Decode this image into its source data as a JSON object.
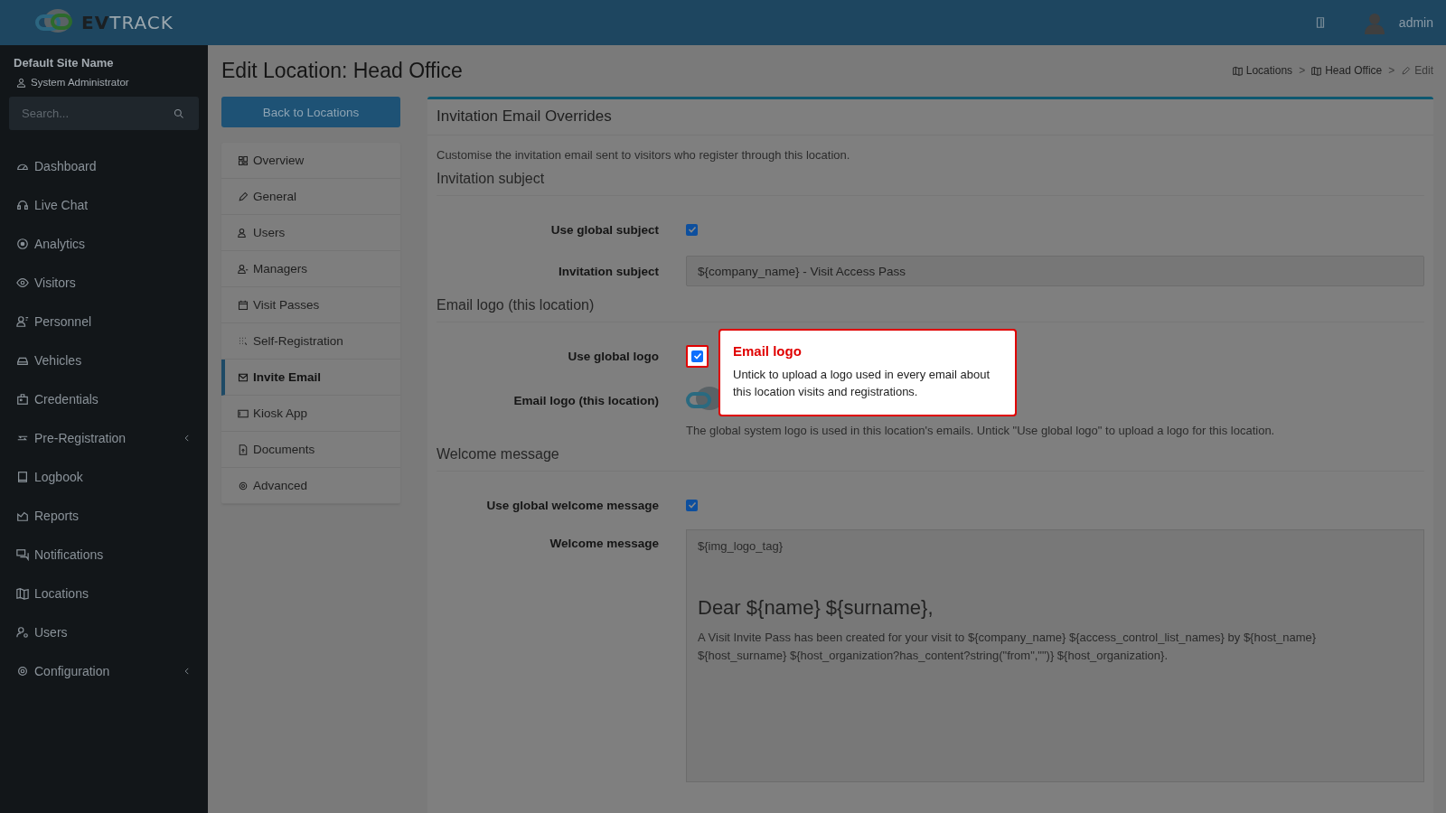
{
  "header": {
    "logo_text": "**EV**TRACK",
    "user": "admin"
  },
  "sidebar": {
    "site_name": "Default Site Name",
    "role": "System Administrator",
    "search_placeholder": "Search...",
    "items": [
      {
        "label": "Dashboard",
        "has_submenu": false
      },
      {
        "label": "Live Chat",
        "has_submenu": false
      },
      {
        "label": "Analytics",
        "has_submenu": false
      },
      {
        "label": "Visitors",
        "has_submenu": false
      },
      {
        "label": "Personnel",
        "has_submenu": false
      },
      {
        "label": "Vehicles",
        "has_submenu": false
      },
      {
        "label": "Credentials",
        "has_submenu": false
      },
      {
        "label": "Pre-Registration",
        "has_submenu": true
      },
      {
        "label": "Logbook",
        "has_submenu": false
      },
      {
        "label": "Reports",
        "has_submenu": false
      },
      {
        "label": "Notifications",
        "has_submenu": false
      },
      {
        "label": "Locations",
        "has_submenu": false
      },
      {
        "label": "Users",
        "has_submenu": false
      },
      {
        "label": "Configuration",
        "has_submenu": true
      }
    ]
  },
  "page": {
    "title": "Edit Location: Head Office",
    "back_button": "Back to Locations",
    "breadcrumb": {
      "separator": ">",
      "items": [
        {
          "label": "Locations",
          "kind": "map"
        },
        {
          "label": "Head Office",
          "kind": "map"
        },
        {
          "label": "Edit",
          "kind": "edit"
        }
      ]
    }
  },
  "tabs": [
    {
      "label": "Overview",
      "selected": false
    },
    {
      "label": "General",
      "selected": false
    },
    {
      "label": "Users",
      "selected": false
    },
    {
      "label": "Managers",
      "selected": false
    },
    {
      "label": "Visit Passes",
      "selected": false
    },
    {
      "label": "Self-Registration",
      "selected": false
    },
    {
      "label": "Invite Email",
      "selected": true
    },
    {
      "label": "Kiosk App",
      "selected": false
    },
    {
      "label": "Documents",
      "selected": false
    },
    {
      "label": "Advanced",
      "selected": false
    }
  ],
  "card": {
    "title": "Invitation Email Overrides",
    "description": "Customise the invitation email sent to visitors who register through this location.",
    "sections": [
      {
        "heading": "Invitation subject",
        "fields": [
          {
            "kind": "checkbox",
            "label": "Use global subject",
            "checked": true,
            "highlighted": false
          },
          {
            "kind": "text",
            "label": "Invitation subject",
            "value": "${company_name} - Visit Access Pass"
          }
        ]
      },
      {
        "heading": "Email logo (this location)",
        "fields": [
          {
            "kind": "checkbox",
            "label": "Use global logo",
            "checked": true,
            "highlighted": true
          },
          {
            "kind": "logo",
            "label": "Email logo (this location)",
            "help": "The global system logo is used in this location's emails. Untick \"Use global logo\" to upload a logo for this location."
          }
        ]
      },
      {
        "heading": "Welcome message",
        "fields": [
          {
            "kind": "checkbox",
            "label": "Use global welcome message",
            "checked": true,
            "highlighted": false
          },
          {
            "kind": "textarea",
            "label": "Welcome message",
            "lines": [
              {
                "kind": "plain",
                "text": "${img_logo_tag}"
              },
              {
                "kind": "heading",
                "text": "Dear ${name} ${surname},"
              },
              {
                "kind": "plain",
                "text": "A Visit Invite Pass has been created for your visit to ${company_name} ${access_control_list_names} by ${host_name} ${host_surname} ${host_organization?has_content?string(\"from\",\"\")} ${host_organization}."
              }
            ]
          }
        ]
      }
    ]
  },
  "tooltip": {
    "title": "Email logo",
    "text": "Untick to upload a logo used in every email about this location visits and registrations."
  }
}
